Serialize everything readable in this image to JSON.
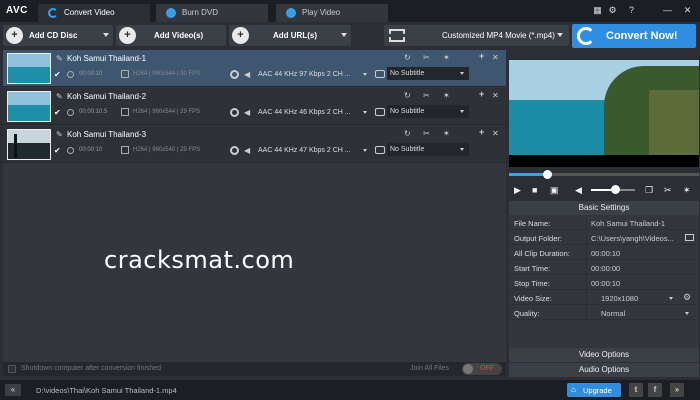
{
  "app": {
    "logo": "AVC"
  },
  "tabs": [
    {
      "label": "Convert Video"
    },
    {
      "label": "Burn DVD"
    },
    {
      "label": "Play Video"
    }
  ],
  "window_controls": {
    "grid": "▦",
    "settings": "⚙",
    "help": "?",
    "minimize": "—",
    "close": "✕"
  },
  "toolbar": {
    "add_cd": "Add CD Disc",
    "add_video": "Add Video(s)",
    "add_url": "Add URL(s)",
    "format": "Customized MP4 Movie (*.mp4)",
    "convert": "Convert Now!"
  },
  "files": [
    {
      "name": "Koh Samui Thailand-1",
      "duration": "00:00:10",
      "video": "H264 | 960x544 | 30 FPS",
      "audio": "AAC 44 KHz 97 Kbps 2 CH ...",
      "subtitle": "No Subtitle",
      "selected": true
    },
    {
      "name": "Koh Samui Thailand-2",
      "duration": "00:00:10.5",
      "video": "H264 | 960x544 | 29 FPS",
      "audio": "AAC 44 KHz 46 Kbps 2 CH ...",
      "subtitle": "No Subtitle",
      "selected": false
    },
    {
      "name": "Koh Samui Thailand-3",
      "duration": "00:00:10",
      "video": "H264 | 960x540 | 29 FPS",
      "audio": "AAC 44 KHz 47 Kbps 2 CH ...",
      "subtitle": "No Subtitle",
      "selected": false
    }
  ],
  "watermark": "cracksmat.com",
  "bottom_options": {
    "shutdown": "Shutdown computer after conversion finished",
    "join": "Join All Files",
    "toggle": "OFF"
  },
  "player": {
    "progress": 0.2,
    "volume": 0.55
  },
  "basic_settings": {
    "title": "Basic Settings",
    "rows": [
      {
        "key": "File Name:",
        "value": "Koh Samui Thailand-1"
      },
      {
        "key": "Output Folder:",
        "value": "C:\\Users\\yangh\\Videos..."
      },
      {
        "key": "All Clip Duration:",
        "value": "00:00:10"
      },
      {
        "key": "Start Time:",
        "value": "00:00:00"
      },
      {
        "key": "Stop Time:",
        "value": "00:00:10"
      },
      {
        "key": "Video Size:",
        "value": "1920x1080"
      },
      {
        "key": "Quality:",
        "value": "Normal"
      }
    ]
  },
  "video_options": "Video Options",
  "audio_options": "Audio Options",
  "footer": {
    "back": "«",
    "path": "D:\\videos\\Thai\\Koh Samui Thailand-1.mp4",
    "upgrade": "Upgrade",
    "twitter": "t",
    "facebook": "f"
  },
  "colors": {
    "accent": "#2f8ee0",
    "selected_row": "#3e5670",
    "background": "#2b2f35"
  }
}
